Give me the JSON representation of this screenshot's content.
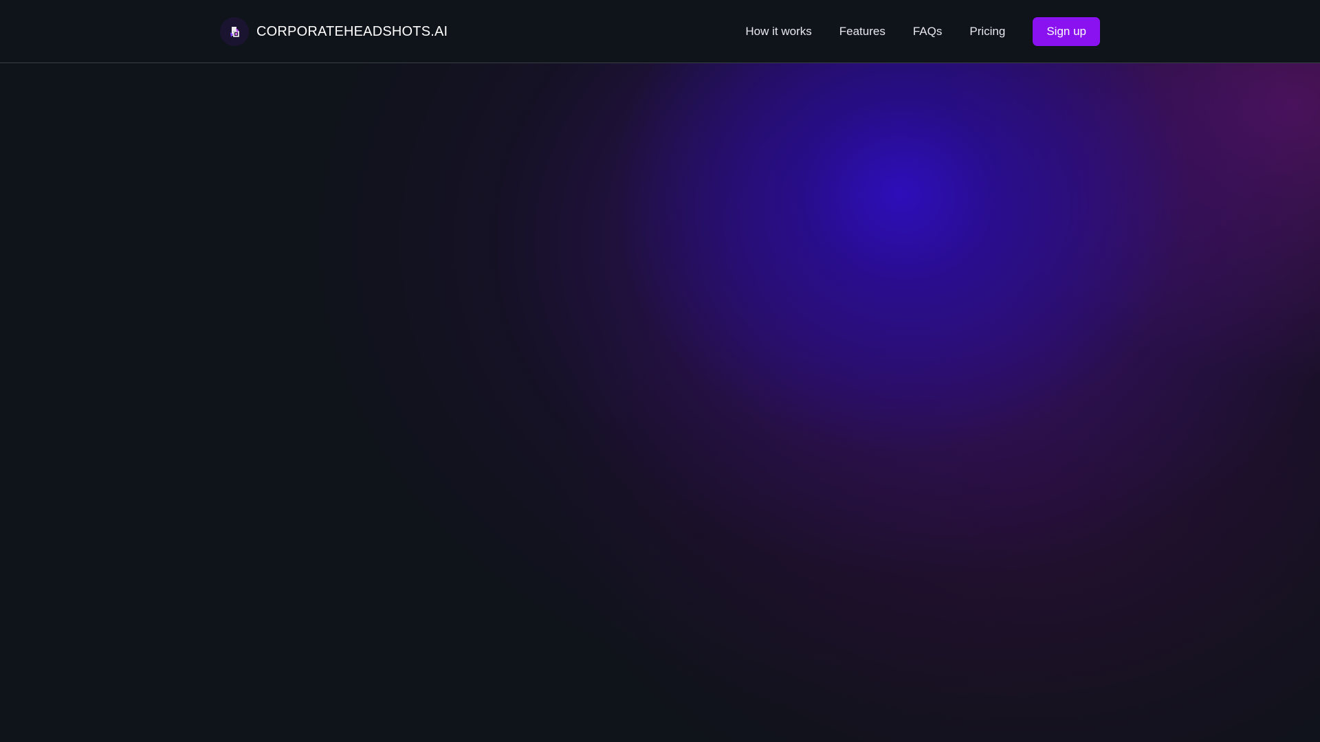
{
  "header": {
    "brand": {
      "name": "CORPORATEHEADSHOTS.AI",
      "logo_icon": "camera-aperture-logo-icon"
    },
    "nav": {
      "items": [
        {
          "label": "How it works"
        },
        {
          "label": "Features"
        },
        {
          "label": "FAQs"
        },
        {
          "label": "Pricing"
        }
      ],
      "signup_label": "Sign up"
    }
  },
  "colors": {
    "background": "#0f131a",
    "accent": "#8a12f0",
    "glow_primary": "#2d0ebe",
    "glow_secondary": "#6e1478"
  }
}
